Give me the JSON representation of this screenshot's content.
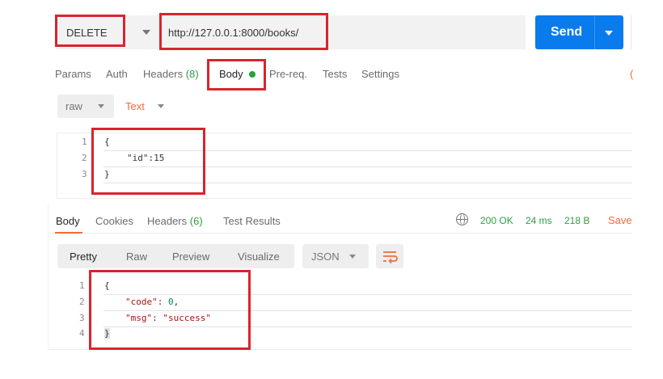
{
  "request": {
    "method": "DELETE",
    "url": "http://127.0.0.1:8000/books/",
    "send_label": "Send"
  },
  "request_tabs": {
    "params": "Params",
    "auth": "Auth",
    "headers": "Headers",
    "headers_count": "(8)",
    "body": "Body",
    "prereq": "Pre-req.",
    "tests": "Tests",
    "settings": "Settings",
    "overflow_glyph": "("
  },
  "body_options": {
    "mode": "raw",
    "language": "Text"
  },
  "request_body": {
    "line_numbers": [
      "1",
      "2",
      "3"
    ],
    "lines": [
      "{",
      "\"id\":15",
      "}"
    ]
  },
  "response_tabs": {
    "body": "Body",
    "cookies": "Cookies",
    "headers": "Headers",
    "headers_count": "(6)",
    "test_results": "Test Results"
  },
  "response_status": {
    "status": "200 OK",
    "time": "24 ms",
    "size": "218 B",
    "save": "Save"
  },
  "response_view": {
    "pretty": "Pretty",
    "raw": "Raw",
    "preview": "Preview",
    "visualize": "Visualize",
    "format": "JSON"
  },
  "response_body": {
    "line_numbers": [
      "1",
      "2",
      "3",
      "4"
    ],
    "open_brace": "{",
    "code_key": "\"code\"",
    "code_value": "0",
    "msg_key": "\"msg\"",
    "msg_value": "\"success\"",
    "close_brace": "}"
  },
  "colors": {
    "accent_orange": "#f26b3a",
    "send_blue": "#097bed",
    "success_green": "#2f9e44",
    "annotation_red": "#d9242e"
  },
  "icons": [
    "chevron-down-icon",
    "status-dot-icon",
    "globe-icon",
    "wrap-lines-icon"
  ]
}
